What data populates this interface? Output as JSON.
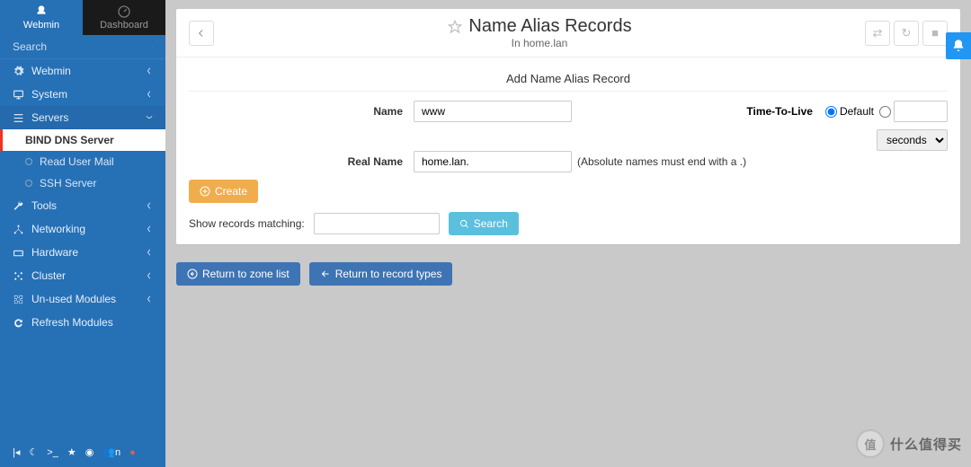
{
  "tabs": {
    "webmin": "Webmin",
    "dashboard": "Dashboard"
  },
  "search": {
    "placeholder": "Search"
  },
  "nav": {
    "webmin": "Webmin",
    "system": "System",
    "servers": "Servers",
    "servers_children": {
      "bind": "BIND DNS Server",
      "mail": "Read User Mail",
      "ssh": "SSH Server"
    },
    "tools": "Tools",
    "networking": "Networking",
    "hardware": "Hardware",
    "cluster": "Cluster",
    "unused": "Un-used Modules",
    "refresh": "Refresh Modules"
  },
  "bottom": {
    "users": "n"
  },
  "header": {
    "title": "Name Alias Records",
    "subtitle": "In home.lan"
  },
  "form": {
    "section_title": "Add Name Alias Record",
    "name_label": "Name",
    "name_value": "www",
    "ttl_label": "Time-To-Live",
    "ttl_default": "Default",
    "ttl_unit": "seconds",
    "realname_label": "Real Name",
    "realname_value": "home.lan.",
    "realname_hint": "(Absolute names must end with a .)",
    "create": "Create",
    "show_matching": "Show records matching:",
    "search": "Search"
  },
  "buttons": {
    "return_zone": "Return to zone list",
    "return_records": "Return to record types"
  },
  "watermark": {
    "char": "值",
    "text": "什么值得买"
  }
}
